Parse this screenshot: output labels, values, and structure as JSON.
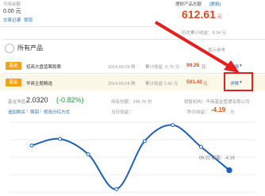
{
  "top": {
    "label": "可用余额",
    "value": "0.00 元",
    "links": [
      "交易记录",
      "提现"
    ],
    "total_label": "理财产品总额",
    "total_update": "[更新]",
    "total_value": "612.61",
    "total_unit": "元",
    "history_income": "历史累计收益：8.34 元"
  },
  "section": {
    "title": "所有产品",
    "extra": "提示参考"
  },
  "products": [
    {
      "badge": "基金",
      "name": "招商大盘蓝筹股票",
      "date": "2014.09.09 购",
      "accum": "累计收益 -0.75 元",
      "amount": "99.25",
      "unit": "元",
      "detail": "详情"
    },
    {
      "badge": "基金",
      "name": "华商主题精选",
      "date": "2014.09.04 购",
      "accum": "累计收益 1.42 元",
      "amount": "501.42",
      "unit": "元",
      "detail": "详情"
    }
  ],
  "fund_info": {
    "nav_label": "基金净值：",
    "nav": "2.0320",
    "nav_change": "(-0.82%)",
    "holding_label": "持有份额：246.76 份",
    "company_label": "销售机构：华商基金管理有限公司",
    "actions": [
      "追加购买",
      "赎回",
      "修改分红方式"
    ],
    "pending_label": "当日收益：",
    "pending_value": "-",
    "yesterday_label": "昨日收益：",
    "yesterday_value": "-4.19",
    "yesterday_unit": "元"
  },
  "chart_data": {
    "type": "line",
    "points": [
      {
        "x": 1,
        "y": 1.8
      },
      {
        "x": 2,
        "y": 2.7
      },
      {
        "x": 3,
        "y": 0.6
      },
      {
        "x": 4,
        "y": -4.2
      },
      {
        "x": 5,
        "y": 2.4
      },
      {
        "x": 6,
        "y": 4.6
      },
      {
        "x": 7,
        "y": 1.6
      },
      {
        "x": 8,
        "y": -1.6
      }
    ],
    "annotation": "09-22 收益：-4.19",
    "colors": {
      "line": "#1a61b8",
      "last_point": "#1a61b8"
    }
  }
}
